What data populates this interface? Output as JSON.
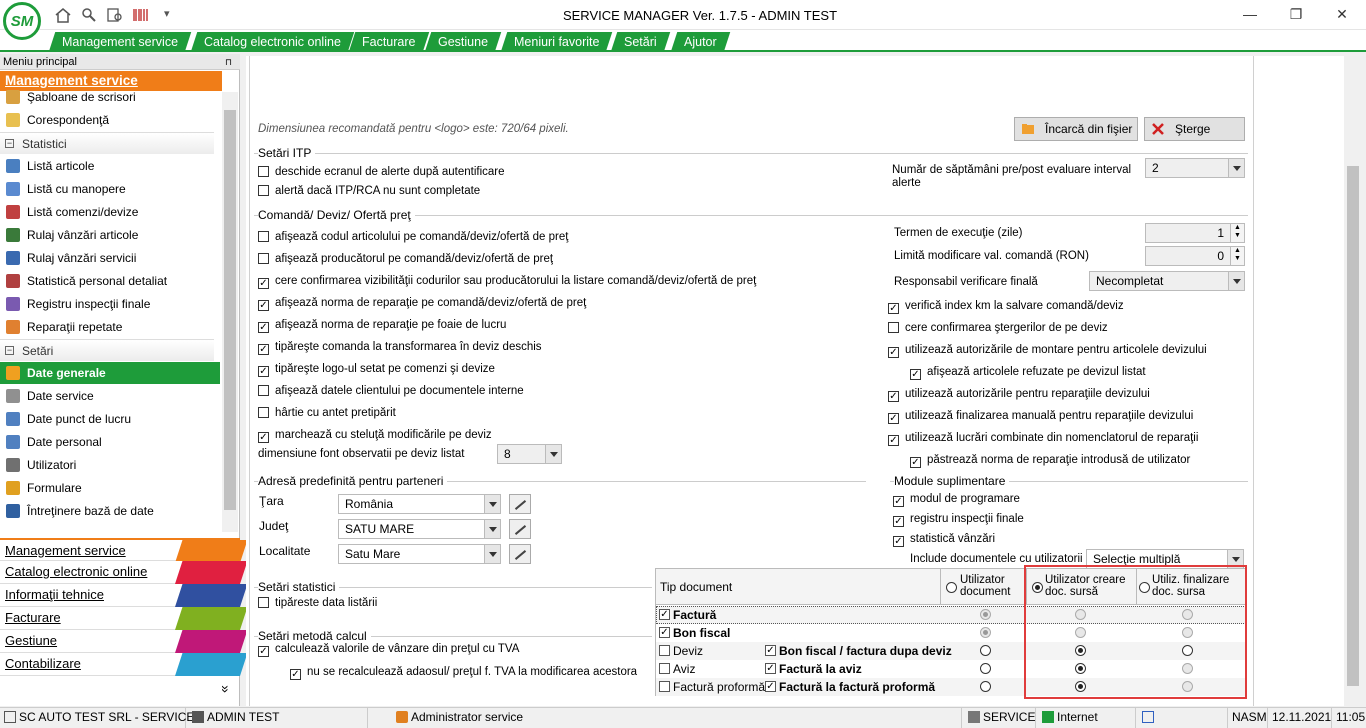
{
  "window": {
    "title": "SERVICE MANAGER Ver. 1.7.5 - ADMIN TEST",
    "logo_text": "SM",
    "qa_more": "▾",
    "minimize": "—",
    "maximize": "❐",
    "close": "✕"
  },
  "menu": {
    "tabs": [
      "Management service",
      "Catalog electronic online",
      "Facturare",
      "Gestiune",
      "Meniuri favorite",
      "Setări",
      "Ajutor"
    ]
  },
  "sidebar": {
    "header": "Meniu principal",
    "pin": "⊓",
    "section": "Management service",
    "items_top": [
      {
        "label": "Şabloane de scrisori",
        "color": "#d8a040"
      },
      {
        "label": "Corespondenţă",
        "color": "#e8c050"
      }
    ],
    "group_statistici": "Statistici",
    "items_stat": [
      {
        "label": "Listă articole",
        "color": "#4a7fc0"
      },
      {
        "label": "Listă cu manopere",
        "color": "#5a8ad0"
      },
      {
        "label": "Listă comenzi/devize",
        "color": "#c04040"
      },
      {
        "label": "Rulaj vânzări articole",
        "color": "#3a7a3a"
      },
      {
        "label": "Rulaj vânzări servicii",
        "color": "#3a6ab0"
      },
      {
        "label": "Statistică personal detaliat",
        "color": "#b04040"
      },
      {
        "label": "Registru inspecţii finale",
        "color": "#7a5ab0"
      },
      {
        "label": "Reparaţii repetate",
        "color": "#e08030"
      }
    ],
    "group_setari": "Setări",
    "items_setari": [
      {
        "label": "Date generale",
        "color": "#f0a020",
        "active": true
      },
      {
        "label": "Date service",
        "color": "#909090"
      },
      {
        "label": "Date punct de lucru",
        "color": "#5080c0"
      },
      {
        "label": "Date personal",
        "color": "#5080c0"
      },
      {
        "label": "Utilizatori",
        "color": "#707070"
      },
      {
        "label": "Formulare",
        "color": "#e0a020"
      },
      {
        "label": "Întreţinere bază de date",
        "color": "#3060a0"
      }
    ],
    "modules": [
      {
        "label": "Management service",
        "color": "#f07d18"
      },
      {
        "label": "Catalog electronic online",
        "color": "#e02040"
      },
      {
        "label": "Informaţii tehnice",
        "color": "#3050a0"
      },
      {
        "label": "Facturare",
        "color": "#80b020"
      },
      {
        "label": "Gestiune",
        "color": "#c01878"
      },
      {
        "label": "Contabilizare",
        "color": "#2aa0d0"
      }
    ],
    "more": "»"
  },
  "logo_section": {
    "hint": "Dimensiunea recomandată pentru <logo> este:  720/64 pixeli.",
    "load_button": "Încarcă din fişier",
    "delete_button": "Şterge"
  },
  "itp": {
    "title": "Setări ITP",
    "cb1": "deschide ecranul de alerte după autentificare",
    "cb2": "alertă dacă ITP/RCA nu sunt completate",
    "weeks_label": "Număr de săptămâni pre/post evaluare interval alerte",
    "weeks_value": "2"
  },
  "cmd": {
    "title": "Comandă/ Deviz/ Ofertă preţ",
    "left": [
      {
        "label": "afişează codul articolului pe comandă/deviz/ofertă de preţ",
        "checked": false
      },
      {
        "label": "afişează producătorul pe comandă/deviz/ofertă de preţ",
        "checked": false
      },
      {
        "label": "cere confirmarea vizibilităţii codurilor sau producătorului la listare comandă/deviz/ofertă de preţ",
        "checked": true
      },
      {
        "label": "afişează norma de reparaţie pe comandă/deviz/ofertă de preţ",
        "checked": true
      },
      {
        "label": "afişează norma de reparaţie pe foaie de lucru",
        "checked": true
      },
      {
        "label": "tipăreşte comanda la transformarea în deviz deschis",
        "checked": true
      },
      {
        "label": "tipăreşte logo-ul setat pe comenzi şi devize",
        "checked": true
      },
      {
        "label": "afişează datele clientului pe documentele interne",
        "checked": false
      },
      {
        "label": "hârtie cu antet pretipărit",
        "checked": false
      },
      {
        "label": "marchează cu steluţă modificările pe deviz",
        "checked": true
      }
    ],
    "font_label": "dimensiune font observatii pe deviz listat",
    "font_value": "8",
    "term_label": "Termen de execuţie (zile)",
    "term_value": "1",
    "limit_label": "Limită modificare val. comandă (RON)",
    "limit_value": "0",
    "resp_label": "Responsabil verificare finală",
    "resp_value": "Necompletat",
    "right": [
      {
        "label": "verifică index km la salvare comandă/deviz",
        "checked": true,
        "indent": false
      },
      {
        "label": "cere confirmarea ştergerilor de pe deviz",
        "checked": false,
        "indent": false
      },
      {
        "label": "utilizează autorizările de montare pentru articolele devizului",
        "checked": true,
        "indent": false
      },
      {
        "label": "afişează articolele refuzate pe devizul listat",
        "checked": true,
        "indent": true
      },
      {
        "label": "utilizează autorizările pentru reparaţiile devizului",
        "checked": true,
        "indent": false
      },
      {
        "label": "utilizează finalizarea manuală pentru reparaţiile devizului",
        "checked": true,
        "indent": false
      },
      {
        "label": "utilizează lucrări combinate din nomenclatorul de reparaţii",
        "checked": true,
        "indent": false
      },
      {
        "label": "păstrează norma de reparaţie introdusă de utilizator",
        "checked": true,
        "indent": true
      }
    ]
  },
  "address": {
    "title": "Adresă predefinită pentru parteneri",
    "country_label": "Ţara",
    "country_value": "România",
    "county_label": "Judeţ",
    "county_value": "SATU MARE",
    "city_label": "Localitate",
    "city_value": "Satu Mare"
  },
  "modules_sup": {
    "title": "Module suplimentare",
    "items": [
      "modul de programare",
      "registru inspecţii finale",
      "statistică vânzări"
    ],
    "include_label": "Include documentele cu utilizatorii",
    "include_value": "Selecţie multiplă"
  },
  "stats": {
    "title": "Setări statistici",
    "cb": "tipăreste data listării"
  },
  "calc": {
    "title": "Setări metodă calcul",
    "cb1": "calculează valorile de vânzare din preţul cu TVA",
    "cb2": "nu se recalculează adaosul/ preţul f. TVA la modificarea acestora"
  },
  "doc_grid": {
    "header_type": "Tip document",
    "col1": "Utilizator document",
    "col2": "Utilizator creare doc. sursă",
    "col3": "Utiliz. finalizare doc. sursa",
    "rows": [
      {
        "type": "Factură",
        "bold": true,
        "checked": true,
        "source": "",
        "source_checked": false,
        "sel": 0,
        "r1": "dis-on",
        "r2": "dis",
        "r3": "dis"
      },
      {
        "type": "Bon fiscal",
        "bold": true,
        "checked": true,
        "source": "",
        "source_checked": false,
        "sel": 0,
        "r1": "dis-on",
        "r2": "dis",
        "r3": "dis"
      },
      {
        "type": "Deviz",
        "bold": false,
        "checked": false,
        "source": "Bon fiscal / factura dupa deviz",
        "source_checked": true,
        "r1": "off",
        "r2": "on",
        "r3": "off"
      },
      {
        "type": "Aviz",
        "bold": false,
        "checked": false,
        "source": "Factură la aviz",
        "source_checked": true,
        "r1": "off",
        "r2": "on",
        "r3": "dis"
      },
      {
        "type": "Factură proformă",
        "bold": false,
        "checked": false,
        "source": "Factură la factură proformă",
        "source_checked": true,
        "r1": "off",
        "r2": "on",
        "r3": "dis"
      }
    ]
  },
  "statusbar": {
    "company": "SC AUTO TEST SRL - SERVICE",
    "user": "ADMIN TEST",
    "role": "Administrator service",
    "module": "SERVICE",
    "connection": "Internet",
    "kbd": "NASM",
    "date": "12.11.2021",
    "time": "11:05"
  }
}
